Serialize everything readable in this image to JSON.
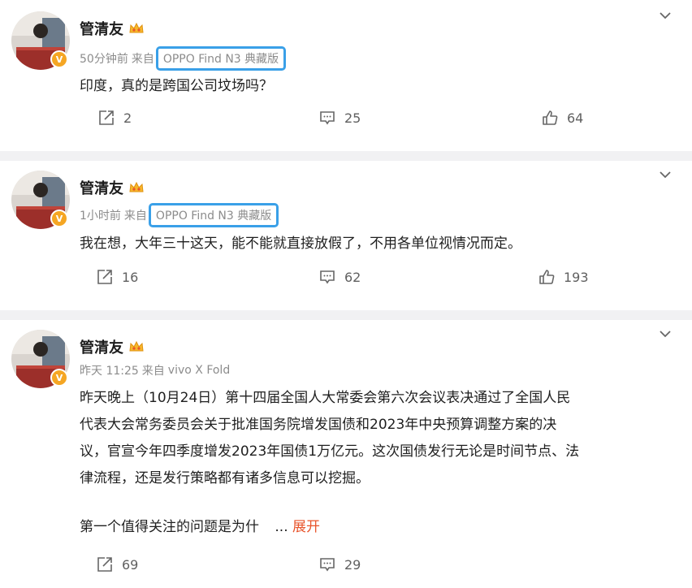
{
  "posts": [
    {
      "author": "管清友",
      "time": "50分钟前",
      "source_prefix": "来自",
      "device": "OPPO Find N3 典藏版",
      "device_highlighted": true,
      "text": "印度，真的是跨国公司坟场吗？",
      "reposts": "2",
      "comments": "25",
      "likes": "64"
    },
    {
      "author": "管清友",
      "time": "1小时前",
      "source_prefix": "来自",
      "device": "OPPO Find N3 典藏版",
      "device_highlighted": true,
      "text": "我在想，大年三十这天，能不能就直接放假了，不用各单位视情况而定。",
      "reposts": "16",
      "comments": "62",
      "likes": "193"
    },
    {
      "author": "管清友",
      "time": "昨天 11:25",
      "source_prefix": "来自",
      "device": "vivo X Fold",
      "device_highlighted": false,
      "text": "昨天晚上（10月24日）第十四届全国人大常委会第六次会议表决通过了全国人民代表大会常务委员会关于批准国务院增发国债和2023年中央预算调整方案的决议，官宣今年四季度增发2023年国债1万亿元。这次国债发行无论是时间节点、法律流程，还是发行策略都有诸多信息可以挖掘。",
      "text_lines": [
        "昨天晚上（10月24日）第十四届全国人大常委会第六次会议表决通过了全国人民",
        "代表大会常务委员会关于批准国务院增发国债和2023年中央预算调整方案的决",
        "议，官宣今年四季度增发2023年国债1万亿元。这次国债发行无论是时间节点、法",
        "律流程，还是发行策略都有诸多信息可以挖掘。"
      ],
      "text_tail": "第一个值得关注的问题是为什",
      "ellipsis": "...",
      "expand_label": "展开",
      "reposts": "69",
      "comments": "29"
    }
  ],
  "colors": {
    "highlight_border": "#3aa0e8",
    "expand_link": "#e8542b",
    "verified_badge": "#f5a623"
  },
  "icons": [
    "chevron-down-icon",
    "repost-icon",
    "comment-icon",
    "like-icon",
    "verified-badge-icon",
    "crown-icon"
  ]
}
